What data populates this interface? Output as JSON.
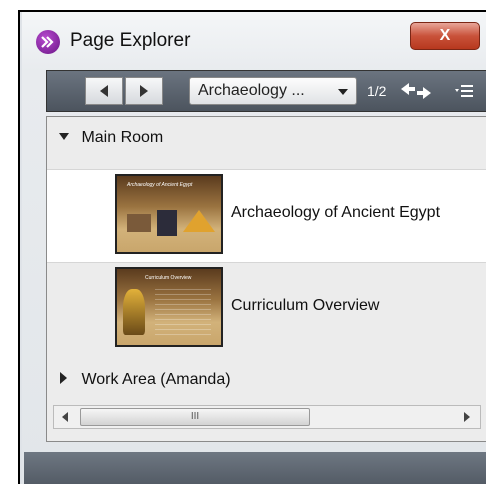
{
  "window": {
    "title": "Page Explorer",
    "close_label": "X"
  },
  "toolbar": {
    "dropdown_value": "Archaeology ...",
    "pager": "1/2"
  },
  "groups": [
    {
      "label": "Main Room",
      "expanded": true
    },
    {
      "label": "Work Area (Amanda)",
      "expanded": false
    }
  ],
  "pages": [
    {
      "label": "Archaeology of Ancient Egypt",
      "thumb_title": "Archaeology of Ancient Egypt",
      "selected": true
    },
    {
      "label": "Curriculum Overview",
      "thumb_title": "Curriculum Overview",
      "selected": false
    }
  ],
  "scrollbar": {
    "grip": "III"
  }
}
